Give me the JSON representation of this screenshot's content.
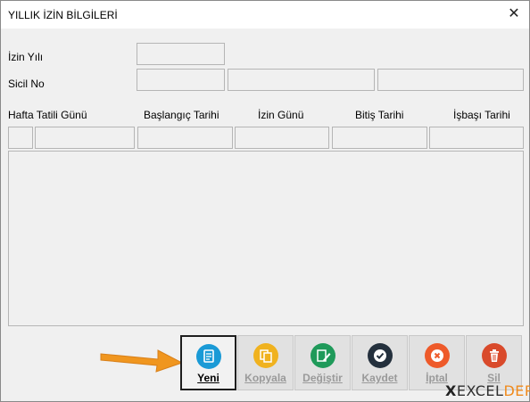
{
  "window": {
    "title": "YILLIK İZİN BİLGİLERİ",
    "close_glyph": "✕"
  },
  "form": {
    "izin_yili_label": "İzin Yılı",
    "sicil_no_label": "Sicil No"
  },
  "columns": [
    "Hafta Tatili Günü",
    "Başlangıç Tarihi",
    "İzin Günü",
    "Bitiş Tarihi",
    "İşbaşı Tarihi"
  ],
  "buttons": [
    {
      "label": "Yeni",
      "icon": "document-icon",
      "color": "#1a9ad6",
      "enabled": true
    },
    {
      "label": "Kopyala",
      "icon": "copy-icon",
      "color": "#f0b21f",
      "enabled": false
    },
    {
      "label": "Değiştir",
      "icon": "edit-icon",
      "color": "#1f9a5a",
      "enabled": false
    },
    {
      "label": "Kaydet",
      "icon": "check-icon",
      "color": "#24303d",
      "enabled": false
    },
    {
      "label": "İptal",
      "icon": "cancel-icon",
      "color": "#ee5a2a",
      "enabled": false
    },
    {
      "label": "Sil",
      "icon": "trash-icon",
      "color": "#d94a2b",
      "enabled": false
    }
  ],
  "annotation": {
    "arrow_color": "#f0961f"
  },
  "watermark": {
    "x": "X",
    "excel": "EXCEL",
    "depo": "DEPO"
  }
}
